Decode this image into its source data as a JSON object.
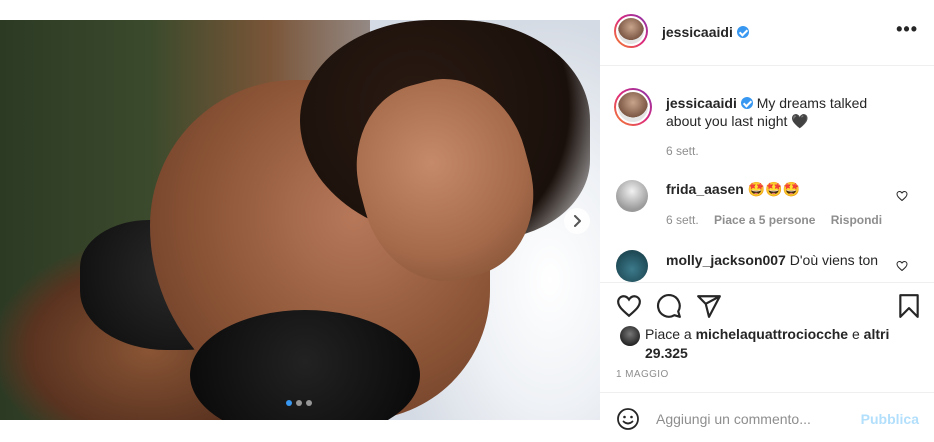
{
  "post": {
    "username": "jessicaaidi",
    "caption": "My dreams talked about you last night",
    "caption_emoji": "🖤",
    "age": "6 sett."
  },
  "comments": [
    {
      "username": "frida_aasen",
      "text": "🤩🤩🤩",
      "age": "6 sett.",
      "likes": "Piace a 5 persone",
      "reply": "Rispondi"
    },
    {
      "username": "molly_jackson007",
      "text": "D'où viens ton"
    }
  ],
  "likes": {
    "prefix": "Piace a",
    "user": "michelaquattrociocche",
    "suffix": "e",
    "others": "altri 29.325"
  },
  "date": "1 MAGGIO",
  "add_comment": {
    "placeholder": "Aggiungi un commento...",
    "post_label": "Pubblica"
  },
  "icons": {
    "more": "more-options-icon",
    "verified": "verified-badge-icon",
    "like": "heart-icon",
    "comment": "comment-icon",
    "share": "share-icon",
    "save": "bookmark-icon",
    "emoji": "emoji-icon",
    "next": "chevron-right-icon"
  },
  "colors": {
    "accent": "#3897f0",
    "post_disabled": "#b2dffc",
    "muted": "#8e8e8e"
  }
}
